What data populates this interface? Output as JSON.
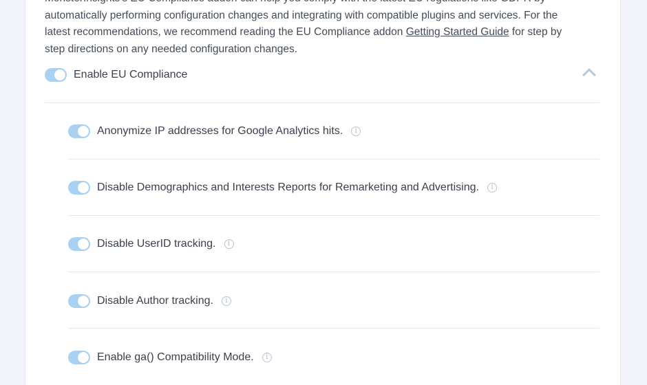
{
  "intro": {
    "line0": "MonsterInsights's EU Compliance addon can help you comply with the latest EU regulations like GDPR by",
    "line1": "automatically performing configuration changes and integrating with compatible plugins and services. For the",
    "line2_before": "latest recommendations, we recommend reading the EU Compliance addon ",
    "link": "Getting Started Guide",
    "line2_after": " for step by",
    "line3": "step directions on any needed configuration changes."
  },
  "master": {
    "label": "Enable EU Compliance",
    "enabled": true,
    "expanded": true
  },
  "settings": [
    {
      "label": "Anonymize IP addresses for Google Analytics hits.",
      "enabled": true,
      "info_glyph": "i"
    },
    {
      "label": "Disable Demographics and Interests Reports for Remarketing and Advertising.",
      "enabled": true,
      "info_glyph": "i"
    },
    {
      "label": "Disable UserID tracking.",
      "enabled": true,
      "info_glyph": "i"
    },
    {
      "label": "Disable Author tracking.",
      "enabled": true,
      "info_glyph": "i"
    },
    {
      "label": "Enable ga() Compatibility Mode.",
      "enabled": true,
      "info_glyph": "i"
    }
  ],
  "colors": {
    "toggle_on": "#a9d1f2",
    "divider": "#dfe9f3",
    "text": "#393f4c"
  }
}
